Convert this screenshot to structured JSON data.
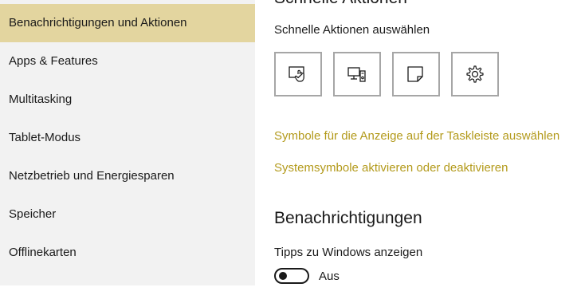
{
  "sidebar": {
    "items": [
      {
        "label": "Benachrichtigungen und Aktionen",
        "selected": true
      },
      {
        "label": "Apps & Features",
        "selected": false
      },
      {
        "label": "Multitasking",
        "selected": false
      },
      {
        "label": "Tablet-Modus",
        "selected": false
      },
      {
        "label": "Netzbetrieb und Energiesparen",
        "selected": false
      },
      {
        "label": "Speicher",
        "selected": false
      },
      {
        "label": "Offlinekarten",
        "selected": false
      }
    ]
  },
  "main": {
    "quick_actions_heading": "Schnelle Aktionen",
    "quick_actions_label": "Schnelle Aktionen auswählen",
    "quick_action_tiles": [
      {
        "icon": "tablet-mode-icon"
      },
      {
        "icon": "project-icon"
      },
      {
        "icon": "note-icon"
      },
      {
        "icon": "settings-gear-icon"
      }
    ],
    "link_taskbar_icons": "Symbole für die Anzeige auf der Taskleiste auswählen",
    "link_system_icons": "Systemsymbole aktivieren oder deaktivieren",
    "notifications_heading": "Benachrichtigungen",
    "tips_label": "Tipps zu Windows anzeigen",
    "tips_toggle_state": "Aus"
  },
  "colors": {
    "accent": "#b39a1b",
    "selected_background": "#e3d59f",
    "sidebar_background": "#f2f2f2"
  }
}
